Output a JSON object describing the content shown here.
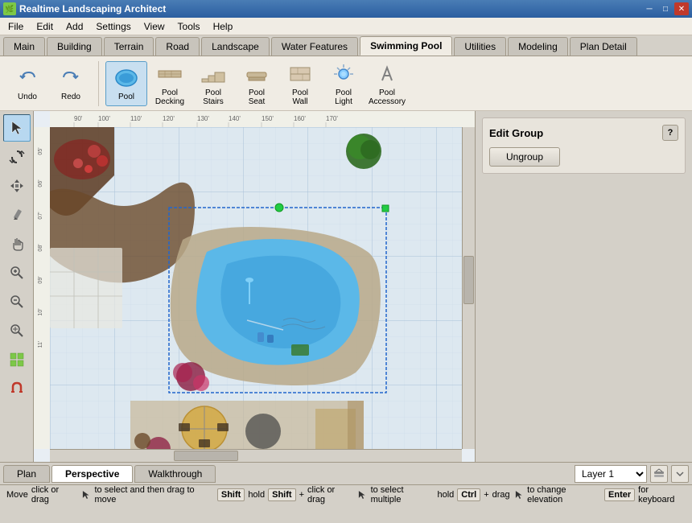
{
  "app": {
    "title": "Realtime Landscaping Architect",
    "icon_label": "RL"
  },
  "titlebar": {
    "minimize_label": "─",
    "maximize_label": "□",
    "close_label": "✕"
  },
  "menubar": {
    "items": [
      "File",
      "Edit",
      "Add",
      "Settings",
      "View",
      "Tools",
      "Help"
    ]
  },
  "tabs": {
    "items": [
      "Main",
      "Building",
      "Terrain",
      "Road",
      "Landscape",
      "Water Features",
      "Swimming Pool",
      "Utilities",
      "Modeling",
      "Plan Detail"
    ]
  },
  "toolbar": {
    "undo_label": "Undo",
    "redo_label": "Redo",
    "pool_label": "Pool",
    "pool_decking_label": "Pool\nDecking",
    "pool_stairs_label": "Pool\nStairs",
    "pool_seat_label": "Pool\nSeat",
    "pool_wall_label": "Pool\nWall",
    "pool_light_label": "Pool\nLight",
    "pool_accessory_label": "Pool\nAccessory"
  },
  "ruler": {
    "marks": [
      "90'",
      "100'",
      "110'",
      "120'",
      "130'",
      "140'",
      "150'",
      "160'",
      "170'"
    ]
  },
  "right_panel": {
    "title": "Edit Group",
    "help_label": "?",
    "ungroup_label": "Ungroup"
  },
  "bottom": {
    "plan_label": "Plan",
    "perspective_label": "Perspective",
    "walkthrough_label": "Walkthrough",
    "layer_label": "Layer 1"
  },
  "statusbar": {
    "move_label": "Move",
    "shift_label": "Shift",
    "ctrl_label": "Ctrl",
    "enter_label": "Enter",
    "click_drag_text": "click or drag",
    "select_move_text": "to select and then drag to move",
    "hold_shift_text": "hold",
    "shift_click_text": "+ click or drag",
    "select_multiple_text": "to select multiple",
    "hold_ctrl_text": "hold",
    "ctrl_drag_text": "+ drag",
    "elevation_text": "to change elevation",
    "keyboard_text": "for keyboard"
  }
}
